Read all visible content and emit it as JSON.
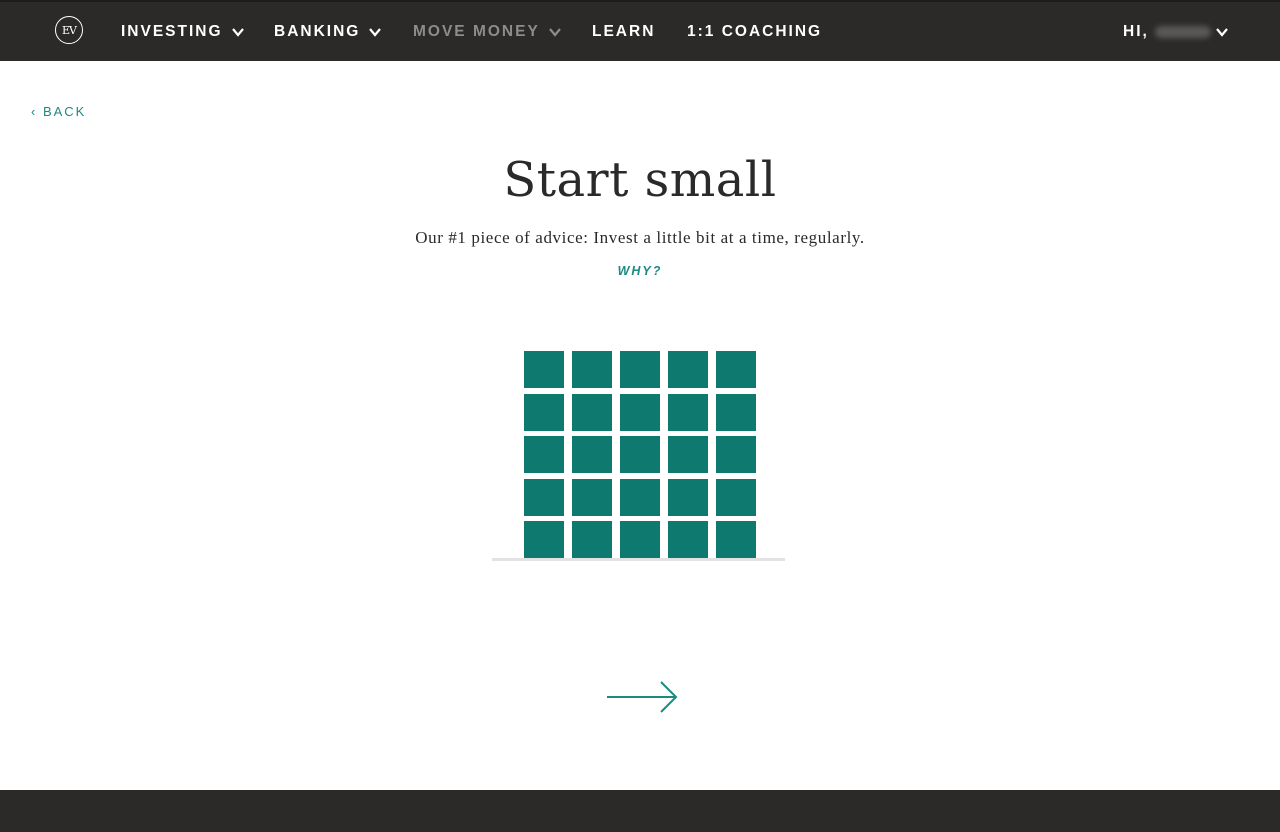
{
  "nav": {
    "logo_text": "EV",
    "items": [
      {
        "label": "INVESTING",
        "has_dropdown": true
      },
      {
        "label": "BANKING",
        "has_dropdown": true
      },
      {
        "label": "MOVE MONEY",
        "has_dropdown": true,
        "muted": true
      },
      {
        "label": "LEARN",
        "has_dropdown": false
      },
      {
        "label": "1:1 COACHING",
        "has_dropdown": false
      }
    ],
    "greeting": "HI,",
    "user_menu_icon": "chevron-down-icon"
  },
  "back_link": "‹ BACK",
  "main": {
    "title": "Start small",
    "subtitle": "Our #1 piece of advice: Invest a little bit at a time, regularly.",
    "why_link": "WHY?"
  },
  "illustration": {
    "rows": 5,
    "columns": 5,
    "block_color": "#0e7a6f"
  },
  "next_icon": "arrow-right-icon",
  "colors": {
    "nav_bg": "#2b2a29",
    "accent": "#1b8a80",
    "text": "#2b2a29"
  }
}
